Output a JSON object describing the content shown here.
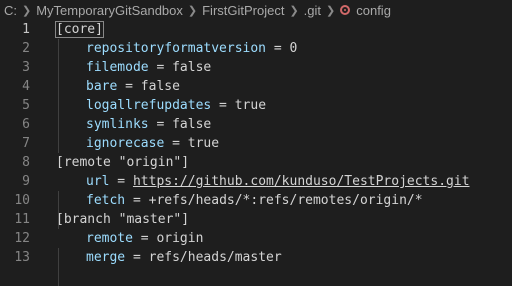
{
  "breadcrumb": {
    "items": [
      "C:",
      "MyTemporaryGitSandbox",
      "FirstGitProject",
      ".git"
    ],
    "file": "config"
  },
  "editor": {
    "lines": [
      {
        "n": "1",
        "section": "[core]"
      },
      {
        "n": "2",
        "key": "repositoryformatversion",
        "value": "0"
      },
      {
        "n": "3",
        "key": "filemode",
        "value": "false"
      },
      {
        "n": "4",
        "key": "bare",
        "value": "false"
      },
      {
        "n": "5",
        "key": "logallrefupdates",
        "value": "true"
      },
      {
        "n": "6",
        "key": "symlinks",
        "value": "false"
      },
      {
        "n": "7",
        "key": "ignorecase",
        "value": "true"
      },
      {
        "n": "8",
        "section": "[remote \"origin\"]"
      },
      {
        "n": "9",
        "key": "url",
        "value": "https://github.com/kunduso/TestProjects.git"
      },
      {
        "n": "10",
        "key": "fetch",
        "value": "+refs/heads/*:refs/remotes/origin/*"
      },
      {
        "n": "11",
        "section": "[branch \"master\"]"
      },
      {
        "n": "12",
        "key": "remote",
        "value": "origin"
      },
      {
        "n": "13",
        "key": "merge",
        "value": "refs/heads/master"
      }
    ]
  },
  "colors": {
    "background": "#1e1e1e",
    "key": "#9cdcfe",
    "text": "#d4d4d4",
    "line_number": "#858585",
    "file_icon": "#d16969"
  },
  "icons": {
    "separator": "chevron-right-icon",
    "file": "config-file-icon"
  }
}
